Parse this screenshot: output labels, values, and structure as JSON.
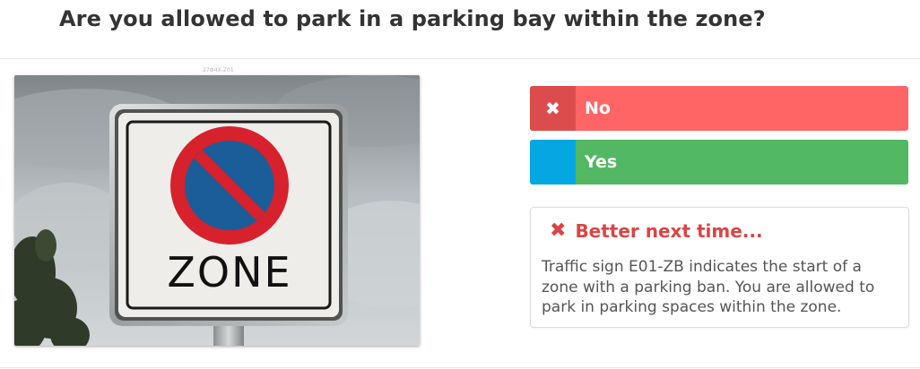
{
  "question": {
    "title": "Are you allowed to park in a parking bay within the zone?"
  },
  "image": {
    "caption": "27Ф4Х-Z01",
    "sign_text": "ZONE",
    "colors": {
      "sign_red": "#d7212d",
      "sign_blue": "#1b5d98"
    }
  },
  "answers": [
    {
      "mark": "✖",
      "label": "No",
      "state": "selected-wrong",
      "color": "#ff6565",
      "mark_color": "#dd4c4c"
    },
    {
      "mark": "",
      "label": "Yes",
      "state": "correct",
      "color": "#52b863",
      "mark_color": "#05a7e3"
    }
  ],
  "feedback": {
    "icon": "close-icon",
    "title": "Better next time...",
    "text": "Traffic sign E01-ZB indicates the start of a zone with a parking ban. You are allowed to park in parking spaces within the zone.",
    "color": "#dc4444"
  }
}
